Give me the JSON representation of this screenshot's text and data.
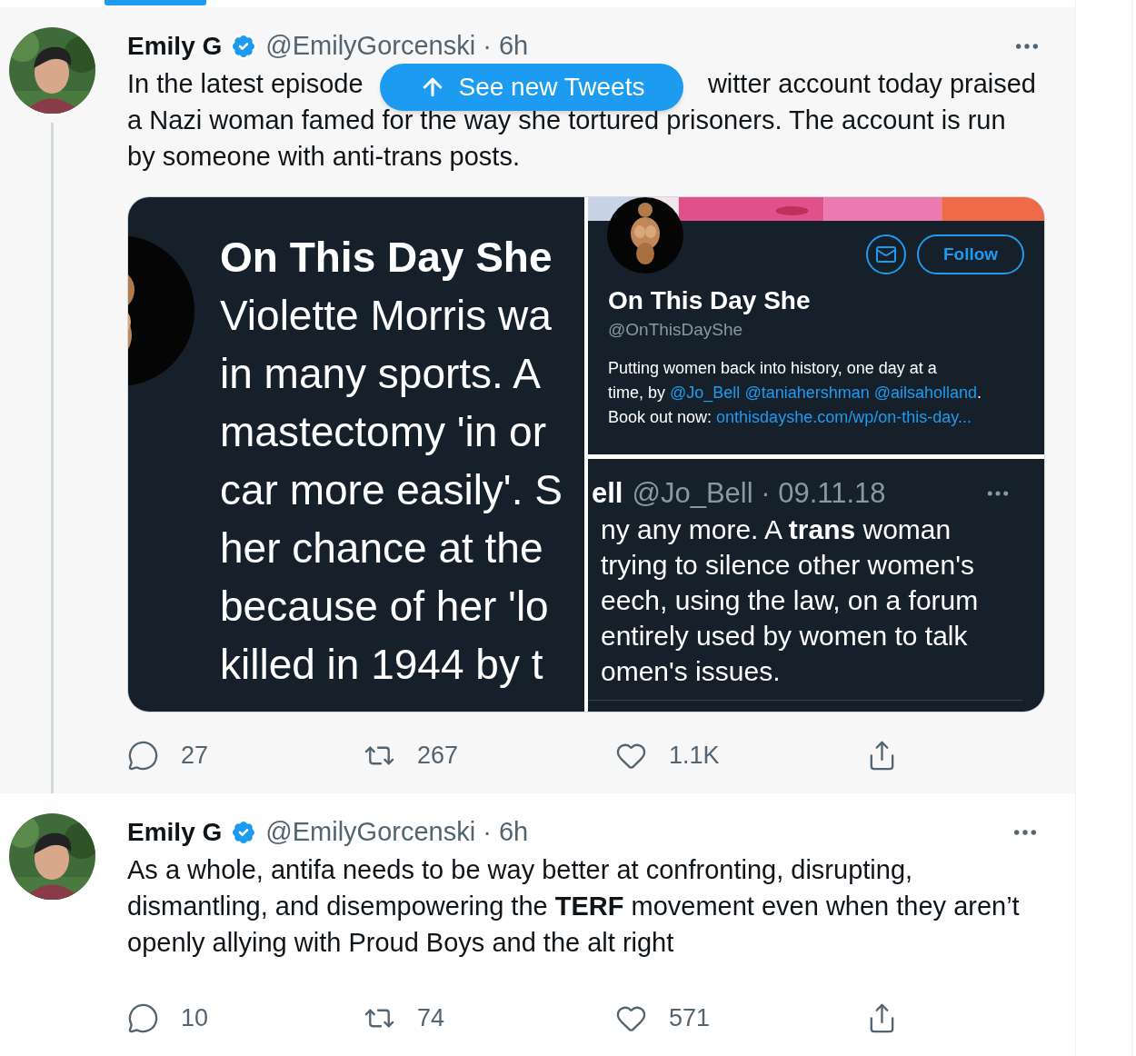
{
  "new_tweets_button": {
    "label": "See new Tweets"
  },
  "tweets": [
    {
      "name": "Emily G",
      "verified": true,
      "meta": "@EmilyGorcenski · 6h",
      "thread": true,
      "highlighted": true,
      "text_cut": {
        "before": "In the latest episode",
        "after": "witter account today praised"
      },
      "text": "a Nazi woman famed for the way she tortured prisoners. The account is run by someone with anti-trans posts.",
      "media": {
        "left_crop": {
          "title": "On This Day She",
          "lines": [
            "Violette Morris wa",
            "in many sports. A",
            "mastectomy 'in or",
            "car more easily'. S",
            "her chance at the",
            "because of her 'lo",
            "killed in 1944 by t"
          ]
        },
        "profile_card": {
          "name": "On This Day She",
          "handle": "@OnThisDayShe",
          "follow_label": "Follow",
          "bio_lines": [
            [
              {
                "kind": "text",
                "text": "Putting women back into history, one day at a"
              }
            ],
            [
              {
                "kind": "text",
                "text": "time, by "
              },
              {
                "kind": "link",
                "text": "@Jo_Bell"
              },
              {
                "kind": "link",
                "text": "@taniahershman"
              },
              {
                "kind": "link",
                "text": "@ailsaholland"
              },
              {
                "kind": "text",
                "text": "."
              }
            ],
            [
              {
                "kind": "text",
                "text": "Book out now: "
              },
              {
                "kind": "link",
                "text": "onthisdayshe.com/wp/on-this-day..."
              }
            ]
          ]
        },
        "quoted_tweet": {
          "name": "ell",
          "meta": "@Jo_Bell · 09.11.18",
          "lines": [
            "ny any more. A **trans** woman",
            "trying to silence other women's",
            "eech, using the law, on a forum",
            "entirely used by women to talk",
            "omen's issues."
          ]
        }
      },
      "actions": [
        {
          "kind": "reply",
          "count": "27"
        },
        {
          "kind": "retweet",
          "count": "267"
        },
        {
          "kind": "like",
          "count": "1.1K"
        },
        {
          "kind": "share"
        }
      ]
    },
    {
      "name": "Emily G",
      "verified": true,
      "meta": "@EmilyGorcenski · 6h",
      "thread": false,
      "highlighted": false,
      "text": "As a whole, antifa needs to be way better at confronting, disrupting, dismantling, and disempowering the **TERF** movement even when they aren’t openly allying with Proud Boys and the alt right",
      "actions": [
        {
          "kind": "reply",
          "count": "10"
        },
        {
          "kind": "retweet",
          "count": "74"
        },
        {
          "kind": "like",
          "count": "571"
        },
        {
          "kind": "share"
        }
      ]
    }
  ]
}
